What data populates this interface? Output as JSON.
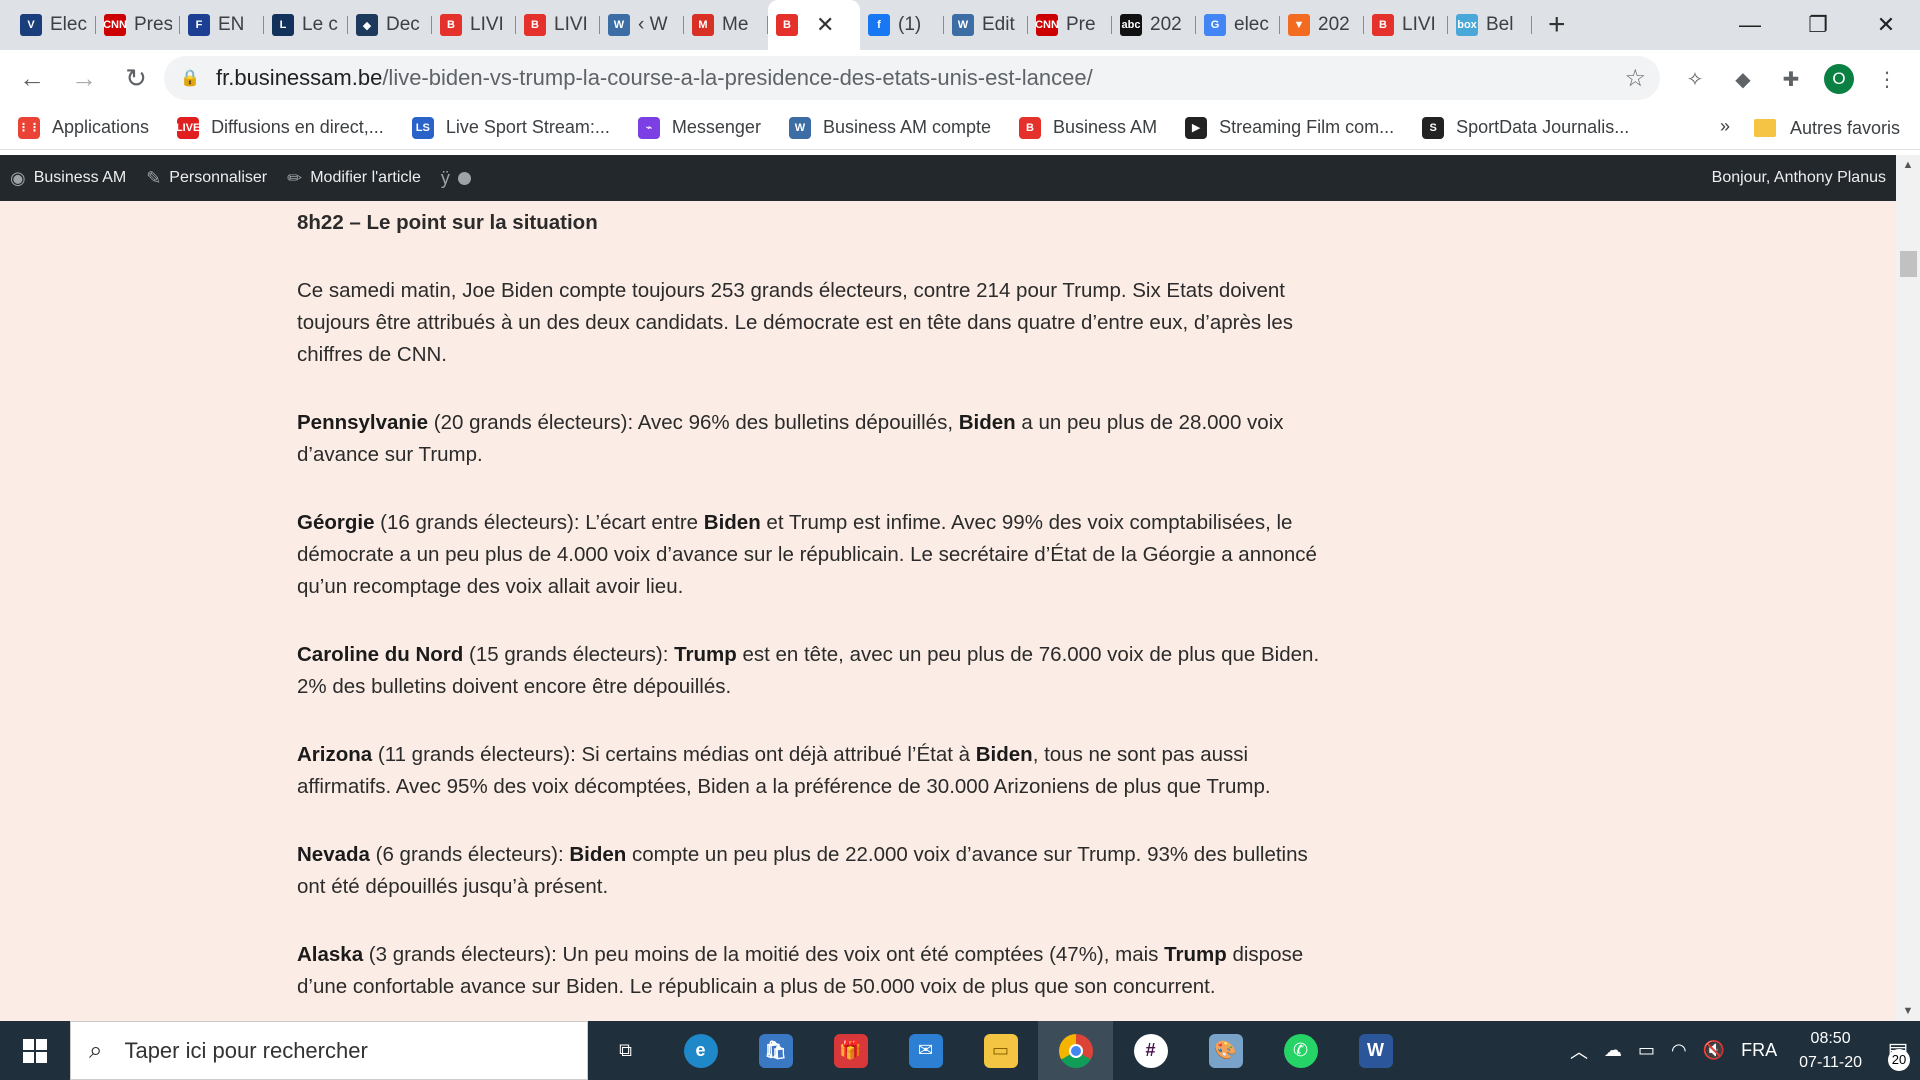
{
  "tabs": [
    {
      "title": "Elec",
      "icon": "politico-icon",
      "color": "#1a3d7c",
      "glyph": "V"
    },
    {
      "title": "Pres",
      "icon": "cnn-icon",
      "color": "#cc0000",
      "glyph": "CNN"
    },
    {
      "title": "EN",
      "icon": "figaro-icon",
      "color": "#1c3f94",
      "glyph": "F"
    },
    {
      "title": "Le c",
      "icon": "lesoir-icon",
      "color": "#12325b",
      "glyph": "L"
    },
    {
      "title": "Dec",
      "icon": "shield-icon",
      "color": "#1d3a5c",
      "glyph": "◆"
    },
    {
      "title": "LIVI",
      "icon": "business-am-icon",
      "color": "#e4312b",
      "glyph": "B"
    },
    {
      "title": "LIVI",
      "icon": "business-am-icon",
      "color": "#e4312b",
      "glyph": "B"
    },
    {
      "title": "‹ W",
      "icon": "wordpress-icon",
      "color": "#3c6ea5",
      "glyph": "W"
    },
    {
      "title": "Me",
      "icon": "gmail-icon",
      "color": "#d93025",
      "glyph": "M"
    },
    {
      "title": "",
      "icon": "business-am-icon",
      "color": "#e4312b",
      "glyph": "B",
      "active": true
    },
    {
      "title": "(1)",
      "icon": "facebook-icon",
      "color": "#1877f2",
      "glyph": "f"
    },
    {
      "title": "Edit",
      "icon": "wordpress-icon",
      "color": "#3c6ea5",
      "glyph": "W"
    },
    {
      "title": "Pre",
      "icon": "cnn-icon",
      "color": "#cc0000",
      "glyph": "CNN"
    },
    {
      "title": "202",
      "icon": "abc-icon",
      "color": "#111111",
      "glyph": "abc"
    },
    {
      "title": "elec",
      "icon": "google-icon",
      "color": "#4285f4",
      "glyph": "G"
    },
    {
      "title": "202",
      "icon": "fivethirtyeight-icon",
      "color": "#f26b21",
      "glyph": "▼"
    },
    {
      "title": "LIVI",
      "icon": "business-am-icon",
      "color": "#e4312b",
      "glyph": "B"
    },
    {
      "title": "Bel",
      "icon": "box-icon",
      "color": "#4aa8d8",
      "glyph": "box"
    }
  ],
  "address": {
    "host": "fr.businessam.be",
    "path": "/live-biden-vs-trump-la-course-a-la-presidence-des-etats-unis-est-lancee/"
  },
  "profile_initial": "O",
  "bookmarks": [
    {
      "label": "Applications",
      "icon": "apps-grid-icon",
      "color": "#ea4335",
      "glyph": "⋮⋮"
    },
    {
      "label": "Diffusions en direct,...",
      "icon": "live-icon",
      "color": "#e02020",
      "glyph": "LIVE"
    },
    {
      "label": "Live Sport Stream:...",
      "icon": "livesport-icon",
      "color": "#2962c9",
      "glyph": "LS"
    },
    {
      "label": "Messenger",
      "icon": "messenger-icon",
      "color": "#7b3fe4",
      "glyph": "⌁"
    },
    {
      "label": "Business AM compte",
      "icon": "wordpress-icon",
      "color": "#3c6ea5",
      "glyph": "W"
    },
    {
      "label": "Business AM",
      "icon": "business-am-icon",
      "color": "#e4312b",
      "glyph": "B"
    },
    {
      "label": "Streaming Film com...",
      "icon": "clapper-icon",
      "color": "#222222",
      "glyph": "▶"
    },
    {
      "label": "SportData Journalis...",
      "icon": "sportdata-icon",
      "color": "#222222",
      "glyph": "S"
    }
  ],
  "bookmarks_more": "»",
  "bookmarks_other": "Autres favoris",
  "adminbar": {
    "site": "Business AM",
    "customize": "Personnaliser",
    "edit": "Modifier l'article",
    "greeting": "Bonjour, Anthony Planus"
  },
  "article": {
    "heading": "8h22 – Le point sur la situation",
    "intro": "Ce samedi matin, Joe Biden compte toujours 253 grands électeurs, contre 214 pour Trump. Six Etats doivent toujours être attribués à un des deux candidats. Le démocrate est en tête dans quatre d’entre eux, d’après les chiffres de CNN.",
    "pa": {
      "state": "Pennsylvanie",
      "t1": " (20 grands électeurs): Avec 96% des bulletins dépouillés, ",
      "lead": "Biden",
      "t2": " a un peu plus de 28.000 voix d’avance sur Trump."
    },
    "ga": {
      "state": "Géorgie",
      "t1": " (16 grands électeurs): L’écart entre ",
      "lead": "Biden",
      "t2": " et Trump est infime. Avec 99% des voix comptabilisées, le démocrate a un peu plus de 4.000 voix d’avance sur le républicain. Le secrétaire d’État de la Géorgie a annoncé qu’un recomptage des voix allait avoir lieu."
    },
    "nc": {
      "state": "Caroline du Nord",
      "t1": " (15 grands électeurs): ",
      "lead": "Trump",
      "t2": " est en tête, avec un peu plus de 76.000 voix de plus que Biden. 2% des bulletins doivent encore être dépouillés."
    },
    "az": {
      "state": "Arizona",
      "t1": " (11 grands électeurs): Si certains médias ont déjà attribué l’État à ",
      "lead": "Biden",
      "t2": ", tous ne sont pas aussi affirmatifs. Avec 95% des voix décomptées, Biden a la préférence de 30.000 Arizoniens de plus que Trump."
    },
    "nv": {
      "state": "Nevada",
      "t1": " (6 grands électeurs): ",
      "lead": "Biden",
      "t2": " compte un peu plus de 22.000 voix d’avance sur Trump. 93% des bulletins ont été dépouillés jusqu’à présent."
    },
    "ak": {
      "state": "Alaska",
      "t1": " (3 grands électeurs): Un peu moins de la moitié des voix ont été comptées (47%), mais ",
      "lead": "Trump",
      "t2": " dispose d’une confortable avance sur Biden. Le républicain a plus de 50.000 voix de plus que son concurrent."
    }
  },
  "taskbar": {
    "search_placeholder": "Taper ici pour rechercher",
    "lang": "FRA",
    "time": "08:50",
    "date": "07-11-20",
    "notifications": "20"
  }
}
